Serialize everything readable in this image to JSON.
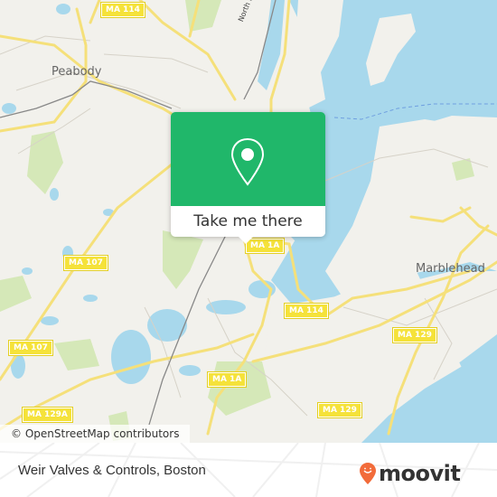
{
  "map": {
    "place_labels": [
      "Peabody",
      "Marblehead"
    ],
    "water_label": "North River",
    "road_shields": [
      "MA 114",
      "MA 107",
      "MA 107",
      "MA 129A",
      "MA 1A",
      "MA 1A",
      "MA 114",
      "MA 129",
      "MA 129"
    ],
    "colors": {
      "land": "#f2f1ec",
      "water": "#a8d8ec",
      "park": "#d5e8b8",
      "road": "#f5e07a",
      "accent": "#20b76a"
    }
  },
  "popup": {
    "icon": "map-pin-icon",
    "cta_label": "Take me there"
  },
  "attribution": "© OpenStreetMap contributors",
  "footer": {
    "title": "Weir Valves & Controls, Boston",
    "logo_text": "moovit",
    "logo_icon": "moovit-pin-icon",
    "logo_color": "#f26b3a"
  }
}
